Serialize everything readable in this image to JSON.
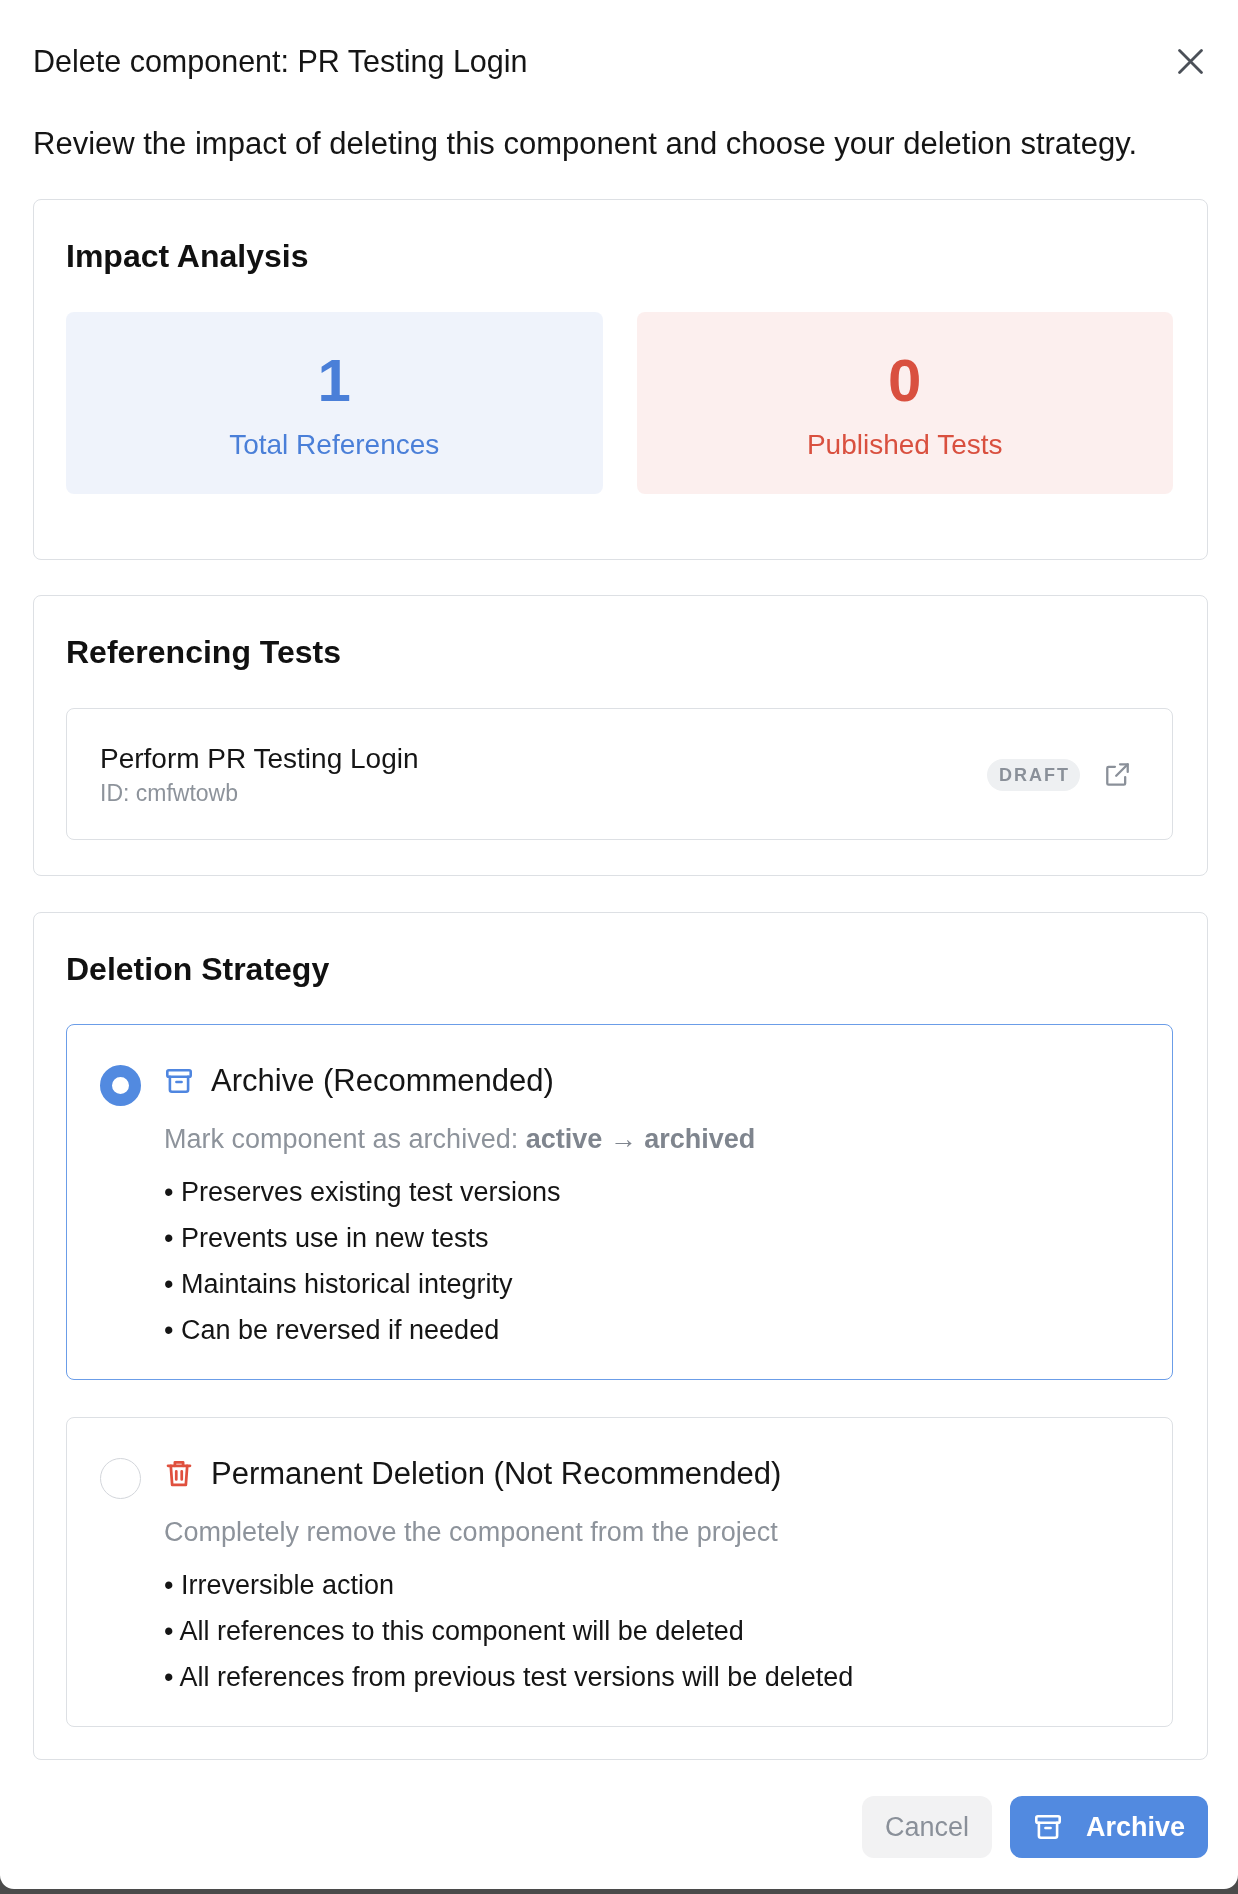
{
  "dialog": {
    "title": "Delete component: PR Testing Login",
    "description": "Review the impact of deleting this component and choose your deletion strategy."
  },
  "impact_analysis": {
    "heading": "Impact Analysis",
    "stats": [
      {
        "value": "1",
        "label": "Total References",
        "color": "#4a7fd8"
      },
      {
        "value": "0",
        "label": "Published Tests",
        "color": "#d9503f"
      }
    ]
  },
  "referencing_tests": {
    "heading": "Referencing Tests",
    "tests": [
      {
        "name": "Perform PR Testing Login",
        "identifier": "ID: cmfwtowb",
        "status": "DRAFT"
      }
    ]
  },
  "deletion_strategy": {
    "heading": "Deletion Strategy",
    "options": [
      {
        "kind": "archive",
        "selected": true,
        "title": "Archive (Recommended)",
        "description": "Mark component as archived: **active → archived**",
        "points": [
          "• Preserves existing test versions",
          "• Prevents use in new tests",
          "• Maintains historical integrity",
          "• Can be reversed if needed"
        ]
      },
      {
        "kind": "delete",
        "selected": false,
        "title": "Permanent Deletion (Not Recommended)",
        "description": "Completely remove the component from the project",
        "points": [
          "• Irreversible action",
          "• All references to this component will be deleted",
          "• All references from previous test versions will be deleted"
        ]
      }
    ]
  },
  "footer": {
    "buttons": [
      {
        "label": "Cancel",
        "kind": "secondary"
      },
      {
        "label": "Archive",
        "kind": "primary"
      }
    ]
  }
}
